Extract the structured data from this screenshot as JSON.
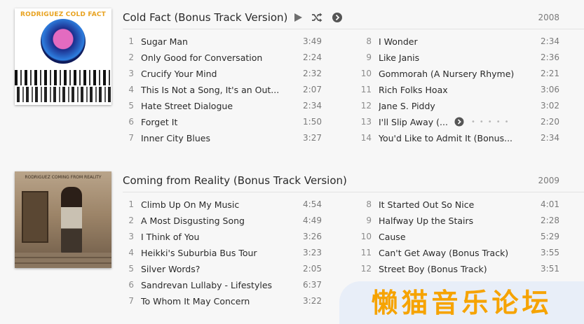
{
  "albums": [
    {
      "title": "Cold Fact (Bonus Track Version)",
      "year": "2008",
      "cover_text": "RODRIGUEZ COLD FACT",
      "left": [
        {
          "n": "1",
          "name": "Sugar Man",
          "dur": "3:49"
        },
        {
          "n": "2",
          "name": "Only Good for Conversation",
          "dur": "2:24"
        },
        {
          "n": "3",
          "name": "Crucify Your Mind",
          "dur": "2:32"
        },
        {
          "n": "4",
          "name": "This Is Not a Song, It's an Out...",
          "dur": "2:07"
        },
        {
          "n": "5",
          "name": "Hate Street Dialogue",
          "dur": "2:34"
        },
        {
          "n": "6",
          "name": "Forget It",
          "dur": "1:50"
        },
        {
          "n": "7",
          "name": "Inner City Blues",
          "dur": "3:27"
        }
      ],
      "right": [
        {
          "n": "8",
          "name": "I Wonder",
          "dur": "2:34"
        },
        {
          "n": "9",
          "name": "Like Janis",
          "dur": "2:36"
        },
        {
          "n": "10",
          "name": "Gommorah (A Nursery Rhyme)",
          "dur": "2:21"
        },
        {
          "n": "11",
          "name": "Rich Folks Hoax",
          "dur": "3:06"
        },
        {
          "n": "12",
          "name": "Jane S. Piddy",
          "dur": "3:02"
        },
        {
          "n": "13",
          "name": "I'll Slip Away (...",
          "dur": "2:20"
        },
        {
          "n": "14",
          "name": "You'd Like to Admit It (Bonus...",
          "dur": "2:34"
        }
      ]
    },
    {
      "title": "Coming from Reality (Bonus Track Version)",
      "year": "2009",
      "cover_text": "RODRIGUEZ COMING FROM REALITY",
      "left": [
        {
          "n": "1",
          "name": "Climb Up On My Music",
          "dur": "4:54"
        },
        {
          "n": "2",
          "name": "A Most Disgusting Song",
          "dur": "4:49"
        },
        {
          "n": "3",
          "name": "I Think of You",
          "dur": "3:26"
        },
        {
          "n": "4",
          "name": "Heikki's Suburbia Bus Tour",
          "dur": "3:23"
        },
        {
          "n": "5",
          "name": "Silver Words?",
          "dur": "2:05"
        },
        {
          "n": "6",
          "name": "Sandrevan Lullaby - Lifestyles",
          "dur": "6:37"
        },
        {
          "n": "7",
          "name": "To Whom It May Concern",
          "dur": "3:22"
        }
      ],
      "right": [
        {
          "n": "8",
          "name": "It Started Out So Nice",
          "dur": "4:01"
        },
        {
          "n": "9",
          "name": "Halfway Up the Stairs",
          "dur": "2:28"
        },
        {
          "n": "10",
          "name": "Cause",
          "dur": "5:29"
        },
        {
          "n": "11",
          "name": "Can't Get Away (Bonus Track)",
          "dur": "3:55"
        },
        {
          "n": "12",
          "name": "Street Boy (Bonus Track)",
          "dur": "3:51"
        }
      ]
    }
  ],
  "watermark": "懒猫音乐论坛",
  "colors": {
    "background": "#f7f7f7",
    "watermark": "#f6a300",
    "watermark_bg": "#e8eef8"
  }
}
